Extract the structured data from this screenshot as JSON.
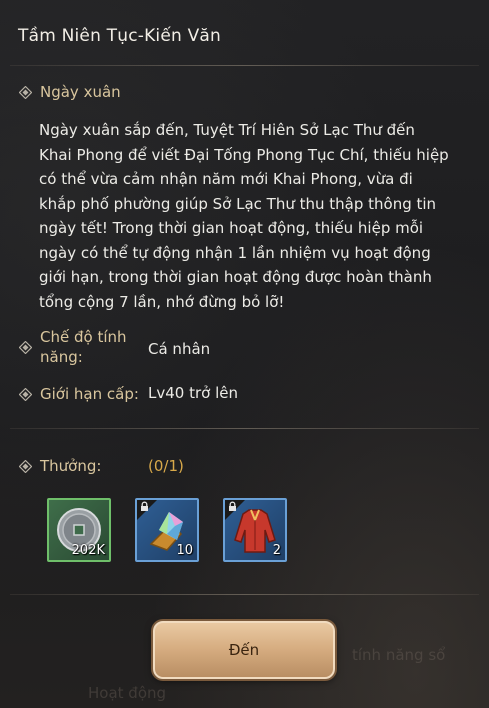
{
  "header": {
    "title": "Tầm Niên Tục-Kiến Văn"
  },
  "section": {
    "heading": "Ngày xuân",
    "description_lines": [
      "Ngày xuân sắp đến, Tuyệt Trí Hiên Sở Lạc Thư đến",
      "Khai Phong để viết Đại Tống Phong Tục Chí, thiếu hiệp",
      "có thể vừa cảm nhận năm mới Khai Phong, vừa đi",
      "khắp phố phường giúp Sở Lạc Thư thu thập thông tin",
      "ngày tết! Trong thời gian hoạt động, thiếu hiệp mỗi",
      "ngày có thể tự động nhận 1 lần nhiệm vụ hoạt động",
      "giới hạn, trong thời gian hoạt động được hoàn thành",
      "tổng cộng 7 lần, nhớ đừng bỏ lỡ!"
    ]
  },
  "mode": {
    "label_line1": "Chế độ tính",
    "label_line2": "năng:",
    "value": "Cá nhân"
  },
  "level": {
    "label": "Giới hạn cấp:",
    "value": "Lv40 trở lên"
  },
  "reward": {
    "label": "Thưởng:",
    "progress": "(0/1)",
    "items": [
      {
        "icon": "coin-icon",
        "count": "202K",
        "rarity": "green",
        "locked": false
      },
      {
        "icon": "crystal-icon",
        "count": "10",
        "rarity": "blue",
        "locked": true
      },
      {
        "icon": "red-robe-icon",
        "count": "2",
        "rarity": "blue",
        "locked": true
      }
    ]
  },
  "action": {
    "go_label": "Đến"
  },
  "background_text": {
    "a": "tính năng sổ",
    "b": "Hoạt động"
  },
  "colors": {
    "gold_label": "#d9c69e",
    "progress": "#d8a94a",
    "button": "#d7ae82"
  }
}
